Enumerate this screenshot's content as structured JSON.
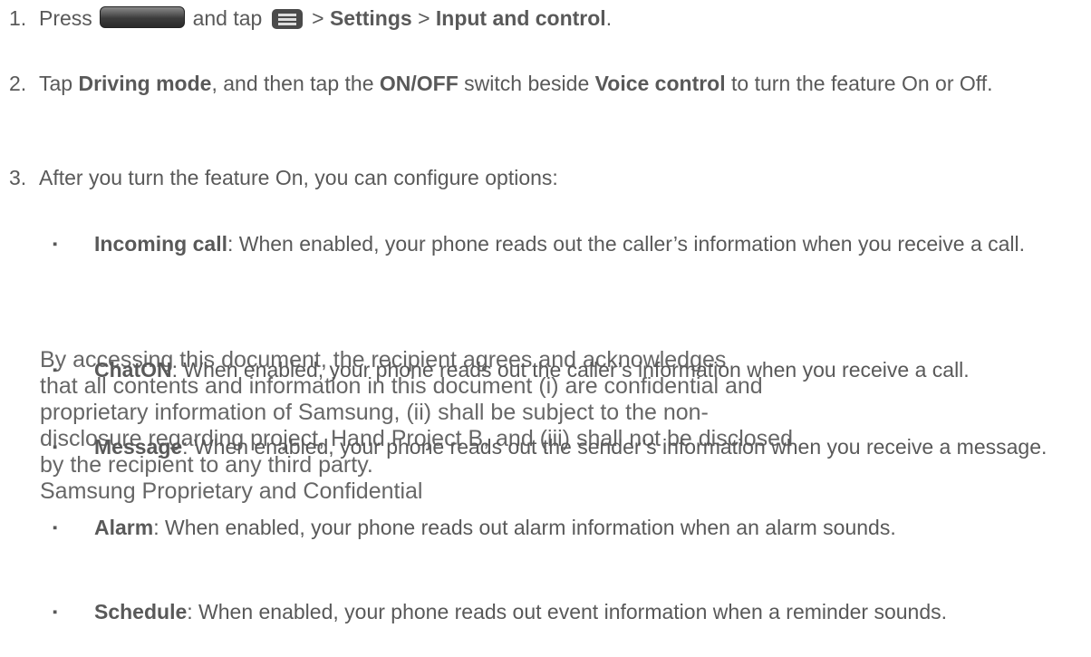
{
  "steps": [
    {
      "num": "1.",
      "press": "Press",
      "and_tap": "and tap",
      "sep1": ">",
      "settings": "Settings",
      "sep2": ">",
      "input": "Input and control",
      "end": "."
    },
    {
      "num": "2.",
      "tap": "Tap",
      "driving": "Driving mode",
      "mid": ", and then tap the",
      "onoff": "ON/OFF",
      "beside": "switch beside",
      "voice": "Voice control",
      "end": "to turn the feature On or Off."
    },
    {
      "num": "3.",
      "text": "After you turn the feature On, you can configure options:"
    }
  ],
  "bullets": [
    {
      "mark": "▪",
      "label": "Incoming call",
      "text": ": When enabled, your phone reads out the caller’s information when you receive a call."
    },
    {
      "mark": "▪",
      "label": "ChatON",
      "text": ": When enabled, your phone reads out the caller’s information when you receive a call."
    },
    {
      "mark": "▪",
      "label": "Message",
      "text": ": When enabled, your phone reads out the sender’s information when you receive a message."
    },
    {
      "mark": "▪",
      "label": "Alarm",
      "text": ": When enabled, your phone reads out alarm information when an alarm sounds."
    },
    {
      "mark": "▪",
      "label": "Schedule",
      "text": ": When enabled, your phone reads out event information when a reminder sounds."
    }
  ],
  "watermark": {
    "line1": "By accessing this document, the recipient agrees and acknowledges",
    "line2": "that all contents and information in this document (i) are confidential and",
    "line3": "proprietary information of Samsung, (ii) shall be subject to the non-",
    "line4": "disclosure regarding project, Hand Project B, and (iii) shall not be disclosed",
    "line5": "by the recipient to any third party.",
    "line6": "Samsung Proprietary and Confidential"
  },
  "icons": {
    "home_key": "home-key-icon",
    "menu_key": "menu-key-icon"
  }
}
